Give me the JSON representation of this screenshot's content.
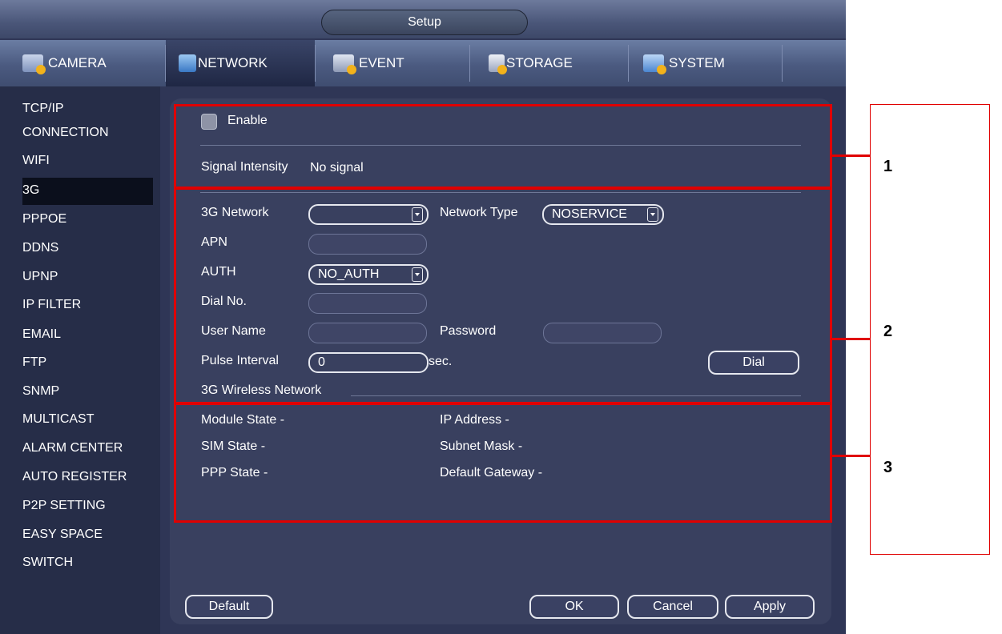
{
  "window": {
    "title": "Setup"
  },
  "tabs": [
    {
      "label": "CAMERA",
      "icon": "camera-gear-icon"
    },
    {
      "label": "NETWORK",
      "icon": "network-icon",
      "active": true
    },
    {
      "label": "EVENT",
      "icon": "event-icon"
    },
    {
      "label": "STORAGE",
      "icon": "storage-icon"
    },
    {
      "label": "SYSTEM",
      "icon": "system-icon"
    }
  ],
  "sidebar": {
    "items": [
      "TCP/IP",
      "CONNECTION",
      "WIFI",
      "3G",
      "PPPOE",
      "DDNS",
      "UPNP",
      "IP FILTER",
      "EMAIL",
      "FTP",
      "SNMP",
      "MULTICAST",
      "ALARM CENTER",
      "AUTO REGISTER",
      "P2P SETTING",
      "EASY SPACE",
      "SWITCH"
    ],
    "active": "3G"
  },
  "section1": {
    "enable_label": "Enable",
    "signal_label": "Signal Intensity",
    "signal_value": "No signal"
  },
  "section2": {
    "network_label": "3G Network",
    "network_value": "",
    "network_type_label": "Network Type",
    "network_type_value": "NOSERVICE",
    "apn_label": "APN",
    "auth_label": "AUTH",
    "auth_value": "NO_AUTH",
    "dial_no_label": "Dial No.",
    "username_label": "User Name",
    "password_label": "Password",
    "pulse_label": "Pulse Interval",
    "pulse_value": "0",
    "pulse_unit": "sec.",
    "dial_button": "Dial",
    "wireless_heading": "3G Wireless Network"
  },
  "section3": {
    "module_state": "Module State",
    "module_state_value": "-",
    "sim_state": "SIM State",
    "sim_state_value": "-",
    "ppp_state": "PPP State",
    "ppp_state_value": "-",
    "ip_address": "IP Address",
    "ip_address_value": "-",
    "subnet_mask": "Subnet Mask",
    "subnet_mask_value": "-",
    "default_gateway": "Default Gateway",
    "default_gateway_value": "-"
  },
  "footer": {
    "default": "Default",
    "ok": "OK",
    "cancel": "Cancel",
    "apply": "Apply"
  },
  "annotations": {
    "callout_1": "1",
    "callout_2": "2",
    "callout_3": "3",
    "color": "#e00000"
  }
}
